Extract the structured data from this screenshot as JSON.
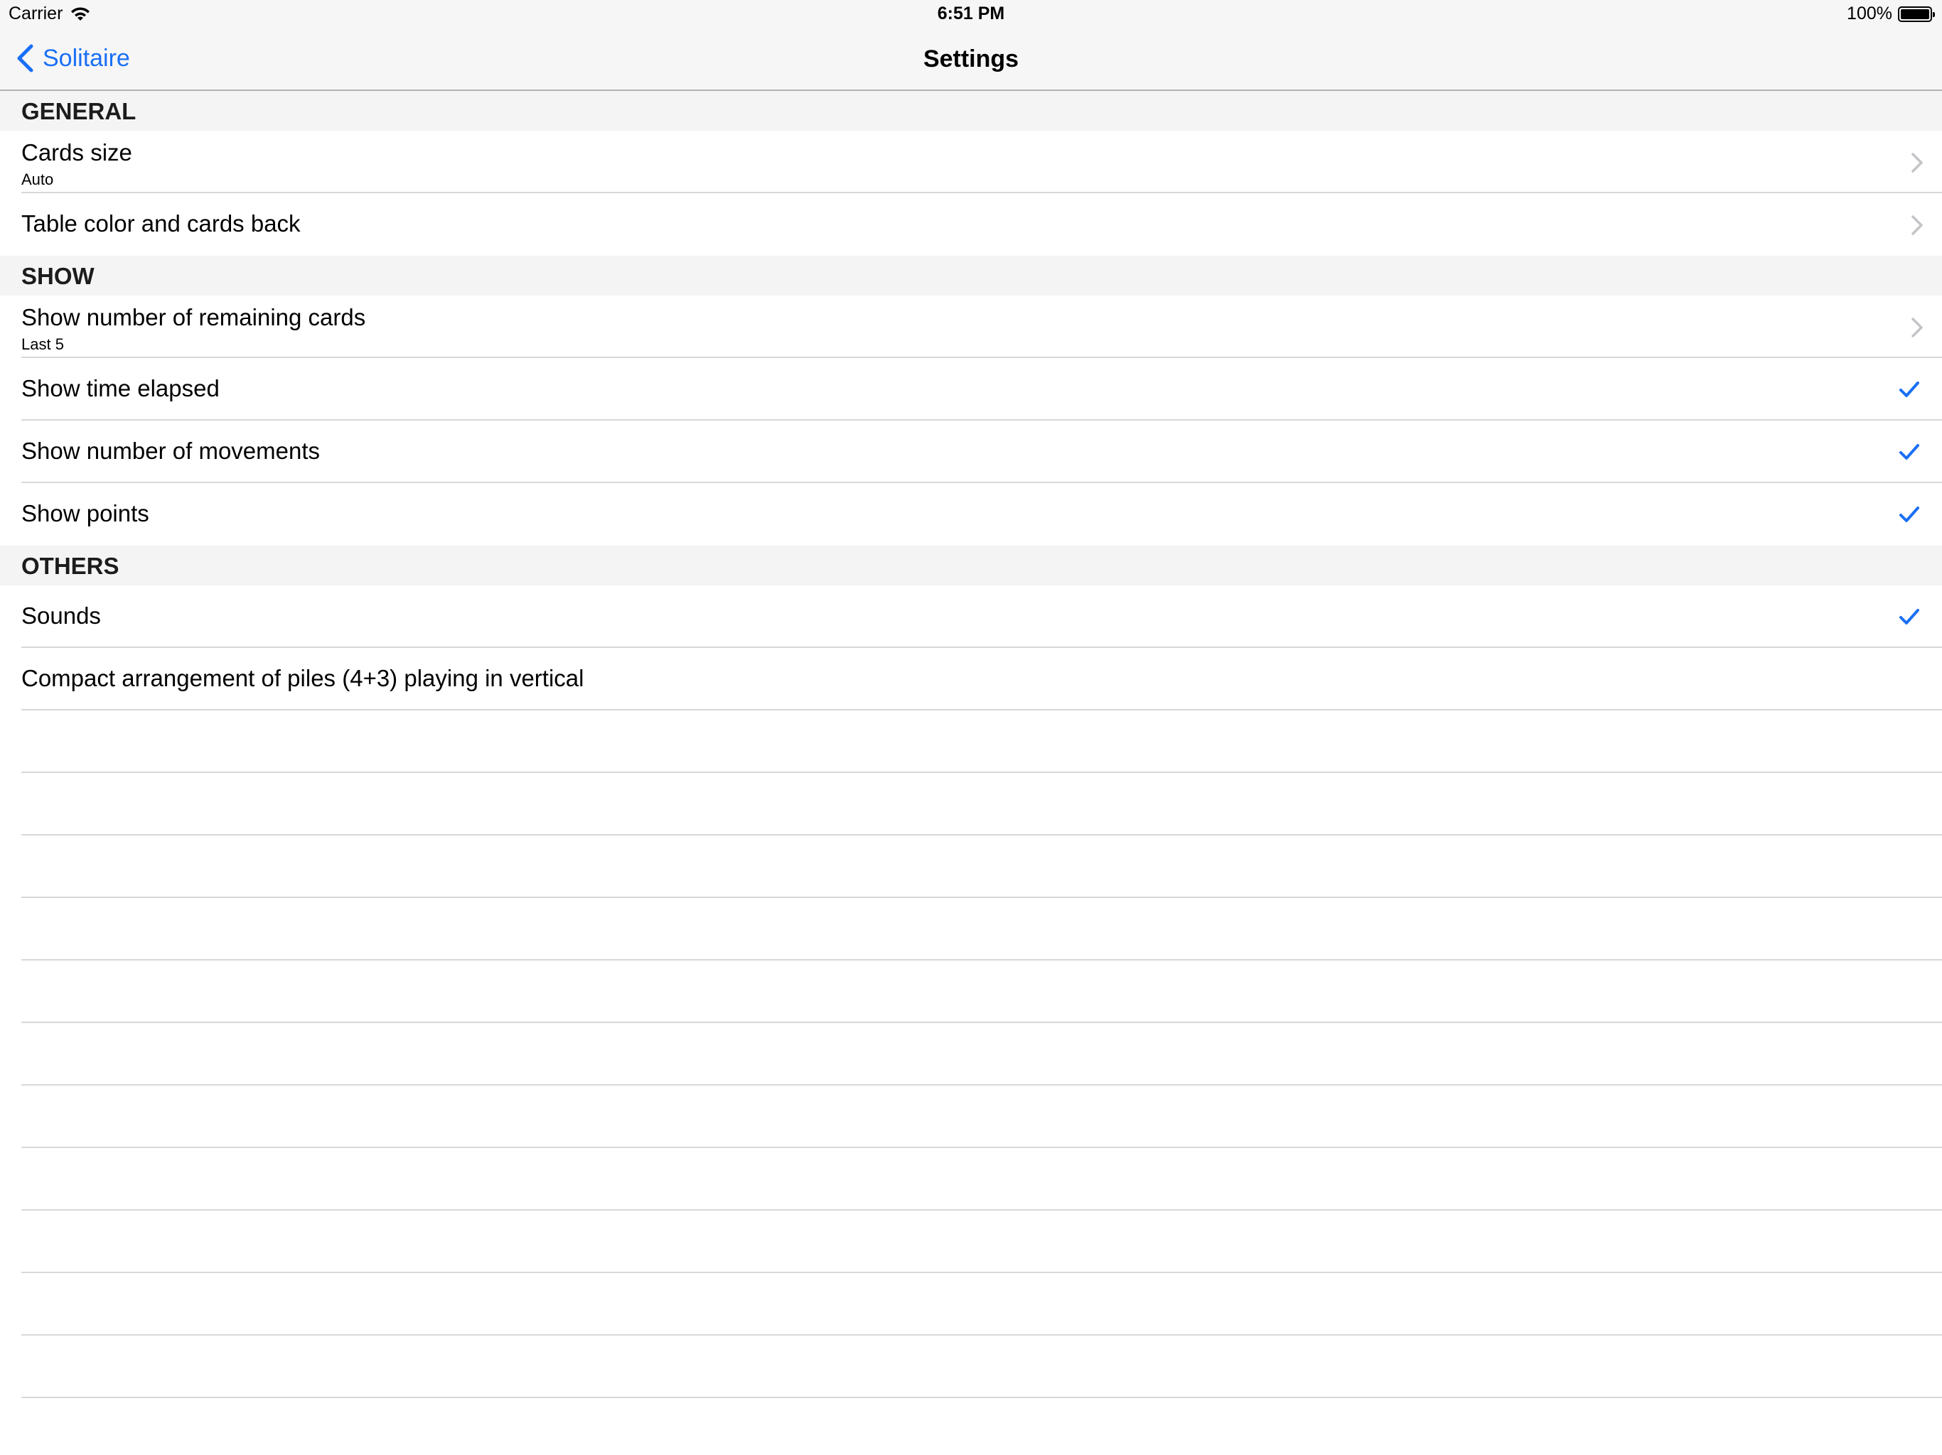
{
  "status": {
    "carrier": "Carrier",
    "time": "6:51 PM",
    "battery": "100%"
  },
  "nav": {
    "back_label": "Solitaire",
    "title": "Settings"
  },
  "sections": {
    "general": {
      "header": "GENERAL",
      "cards_size": {
        "title": "Cards size",
        "subtitle": "Auto"
      },
      "table_color": {
        "title": "Table color and cards back"
      }
    },
    "show": {
      "header": "SHOW",
      "remaining": {
        "title": "Show number of remaining cards",
        "subtitle": "Last 5"
      },
      "time_elapsed": {
        "title": "Show time elapsed",
        "checked": true
      },
      "movements": {
        "title": "Show number of movements",
        "checked": true
      },
      "points": {
        "title": "Show points",
        "checked": true
      }
    },
    "others": {
      "header": "OTHERS",
      "sounds": {
        "title": "Sounds",
        "checked": true
      },
      "compact": {
        "title": "Compact arrangement of piles (4+3) playing in vertical",
        "checked": false
      }
    }
  },
  "colors": {
    "accent": "#1a6ff5",
    "header_bg": "#f4f4f4",
    "separator": "#d8d8d8"
  }
}
